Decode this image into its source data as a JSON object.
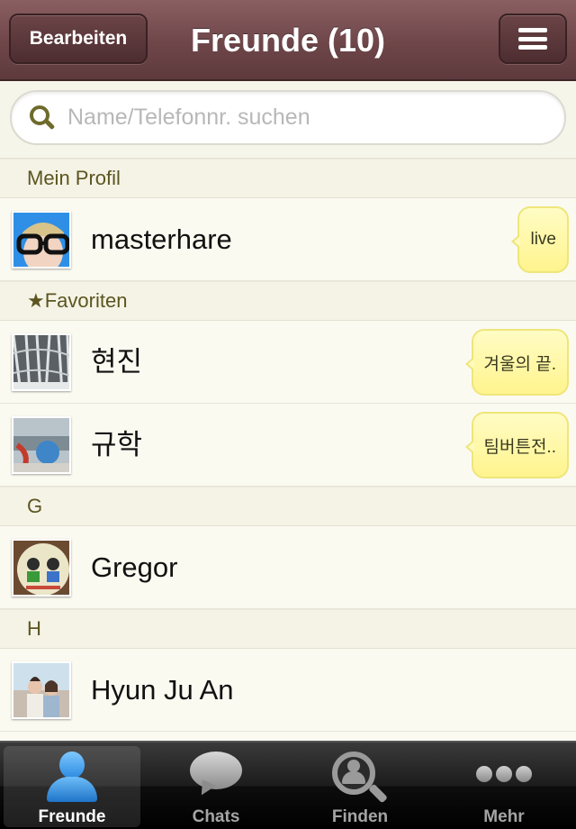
{
  "navbar": {
    "title": "Freunde (10)",
    "edit_label": "Bearbeiten",
    "menu_icon": "hamburger-menu-icon"
  },
  "search": {
    "placeholder": "Name/Telefonnr. suchen",
    "value": "",
    "icon": "search-icon"
  },
  "sections": {
    "profile": "Mein Profil",
    "favorites": "★Favoriten",
    "g": "G",
    "h": "H"
  },
  "profile": {
    "name": "masterhare",
    "status": "live"
  },
  "favorites": [
    {
      "name": "현진",
      "status": "겨울의 끝."
    },
    {
      "name": "규학",
      "status": "팀버튼전.."
    }
  ],
  "friends": [
    {
      "name": "Gregor"
    },
    {
      "name": "Hyun Ju An"
    }
  ],
  "tabs": [
    {
      "label": "Freunde",
      "icon": "person-icon",
      "active": true
    },
    {
      "label": "Chats",
      "icon": "chat-bubble-icon",
      "active": false
    },
    {
      "label": "Finden",
      "icon": "find-friends-icon",
      "active": false
    },
    {
      "label": "Mehr",
      "icon": "more-dots-icon",
      "active": false
    }
  ],
  "colors": {
    "navbar": "#6e4649",
    "background": "#fbfaf1",
    "section_text": "#5b5520",
    "status_bubble": "#fff48e",
    "tab_active": "#ffffff"
  }
}
